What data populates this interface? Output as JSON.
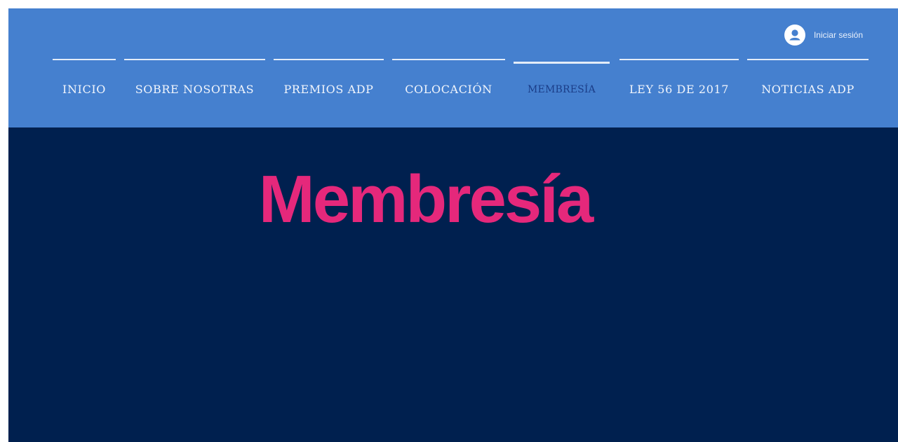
{
  "header": {
    "login": {
      "label": "Iniciar sesión",
      "icon": "user-avatar-icon"
    },
    "nav": [
      {
        "label": "INICIO",
        "active": false
      },
      {
        "label": "SOBRE NOSOTRAS",
        "active": false
      },
      {
        "label": "PREMIOS ADP",
        "active": false
      },
      {
        "label": "COLOCACIÓN",
        "active": false
      },
      {
        "label": "MEMBRESÍA",
        "active": true
      },
      {
        "label": "LEY 56 DE 2017",
        "active": false
      },
      {
        "label": "NOTICIAS ADP",
        "active": false
      }
    ]
  },
  "hero": {
    "title": "Membresía"
  },
  "colors": {
    "header_bg": "#4580cf",
    "hero_bg": "#00204f",
    "accent": "#e5287b",
    "active_nav": "#1b3d88"
  }
}
